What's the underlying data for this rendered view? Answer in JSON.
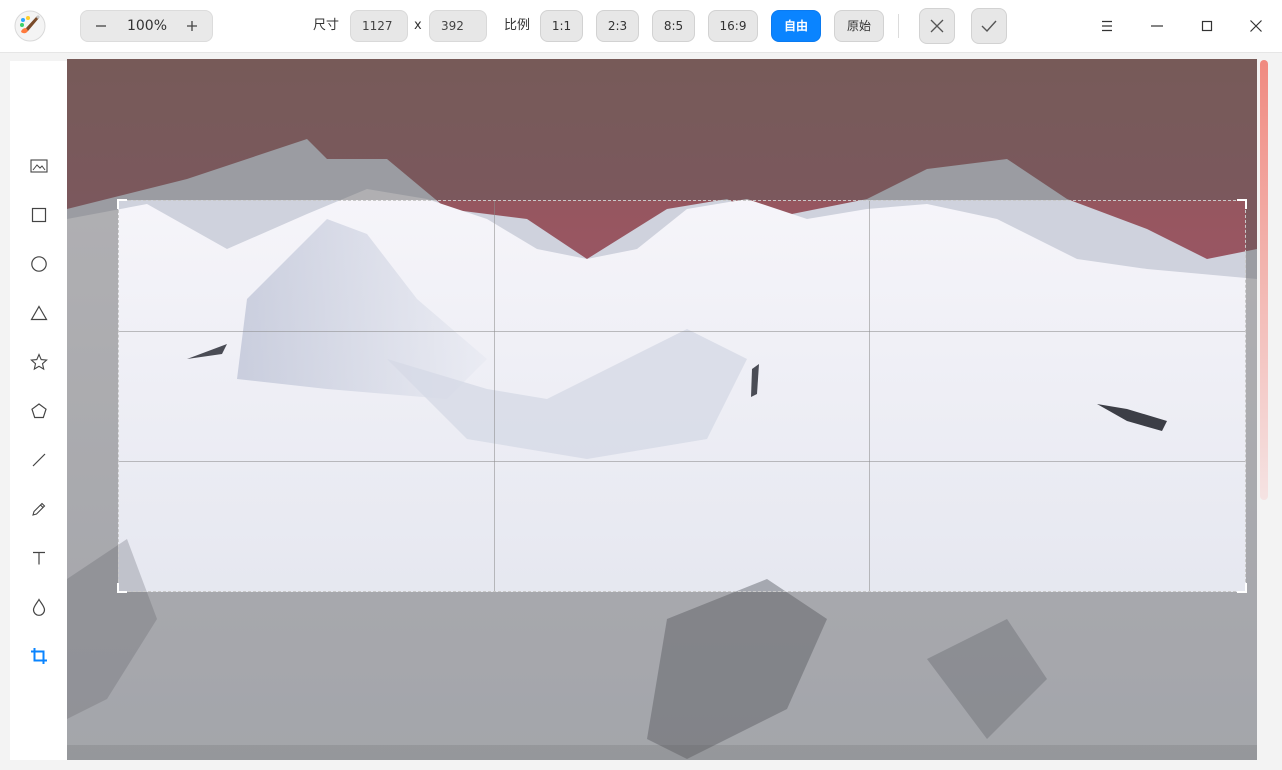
{
  "toolbar": {
    "zoom_value": "100%",
    "size_label": "尺寸",
    "width_value": "1127",
    "times_sign": "x",
    "height_value": "392",
    "ratio_label": "比例",
    "ratios": [
      "1:1",
      "2:3",
      "8:5",
      "16:9",
      "自由",
      "原始"
    ],
    "active_ratio": "自由"
  },
  "icons": {
    "app": "paintbrush-app-icon",
    "zoom_out": "minus-icon",
    "zoom_in": "plus-icon",
    "cancel": "close-icon",
    "confirm": "check-icon",
    "menu": "hamburger-menu-icon",
    "minimize": "minimize-icon",
    "maximize": "maximize-icon",
    "close_window": "window-close-icon"
  },
  "sidebar": {
    "tools": [
      "image-tool-icon",
      "rectangle-tool-icon",
      "ellipse-tool-icon",
      "triangle-tool-icon",
      "star-tool-icon",
      "polygon-tool-icon",
      "line-tool-icon",
      "pencil-tool-icon",
      "text-tool-icon",
      "blur-tool-icon",
      "crop-tool-icon"
    ],
    "active_tool": "crop-tool-icon"
  },
  "colors": {
    "accent": "#0a84ff",
    "sky_top": "#8e5a57",
    "sky_bottom": "#a84f86",
    "snow": "#eef0f6"
  }
}
